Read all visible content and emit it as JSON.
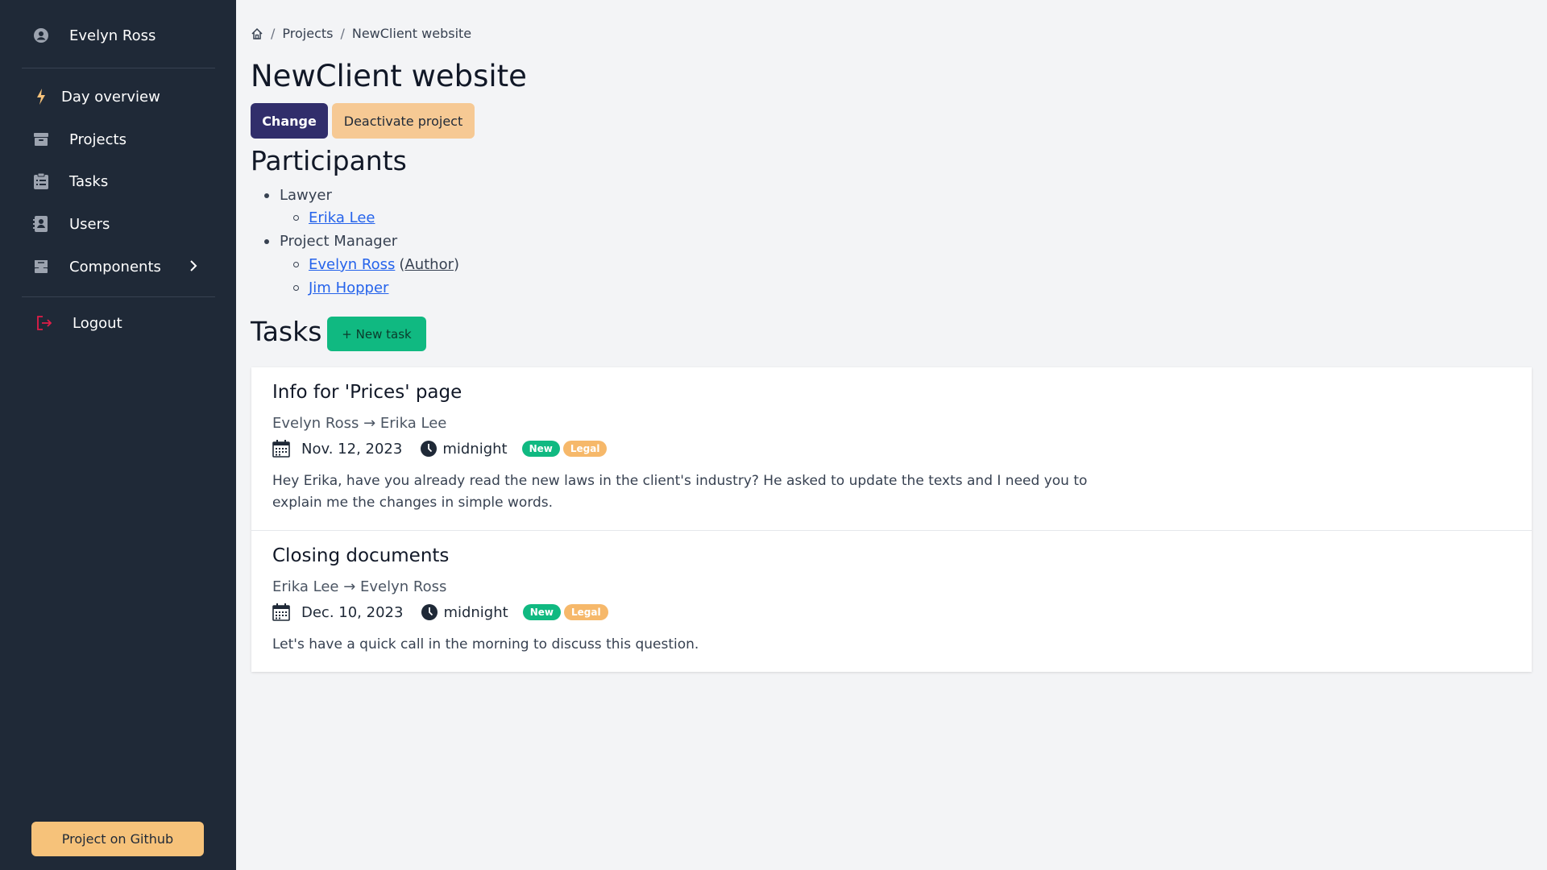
{
  "sidebar": {
    "user_name": "Evelyn Ross",
    "items": [
      {
        "label": "Day overview",
        "icon": "bolt-icon"
      },
      {
        "label": "Projects",
        "icon": "archive-icon"
      },
      {
        "label": "Tasks",
        "icon": "clipboard-icon"
      },
      {
        "label": "Users",
        "icon": "address-book-icon"
      },
      {
        "label": "Components",
        "icon": "inbox-icon"
      }
    ],
    "logout_label": "Logout",
    "github_label": "Project on Github"
  },
  "breadcrumb": {
    "items": [
      "Projects",
      "NewClient website"
    ],
    "separator": "/"
  },
  "project": {
    "title": "NewClient website",
    "change_label": "Change",
    "deactivate_label": "Deactivate project"
  },
  "participants": {
    "heading": "Participants",
    "roles": [
      {
        "role": "Lawyer",
        "people": [
          {
            "name": "Erika Lee",
            "note": ""
          }
        ]
      },
      {
        "role": "Project Manager",
        "people": [
          {
            "name": "Evelyn Ross",
            "note": "Author"
          },
          {
            "name": "Jim Hopper",
            "note": ""
          }
        ]
      }
    ]
  },
  "tasks": {
    "heading": "Tasks",
    "new_task_label": "+ New task",
    "items": [
      {
        "title": "Info for 'Prices' page",
        "from_to": "Evelyn Ross → Erika Lee",
        "date": "Nov. 12, 2023",
        "time": "midnight",
        "badges": [
          "New",
          "Legal"
        ],
        "description": "Hey Erika, have you already read the new laws in the client's industry? He asked to update the texts and I need you to explain me the changes in simple words."
      },
      {
        "title": "Closing documents",
        "from_to": "Erika Lee → Evelyn Ross",
        "date": "Dec. 10, 2023",
        "time": "midnight",
        "badges": [
          "New",
          "Legal"
        ],
        "description": "Let's have a quick call in the morning to discuss this question."
      }
    ]
  },
  "colors": {
    "sidebar_bg": "#1f2937",
    "primary": "#312e6b",
    "warning": "#f6c994",
    "success": "#10b981",
    "logout_icon": "#e11d48"
  }
}
